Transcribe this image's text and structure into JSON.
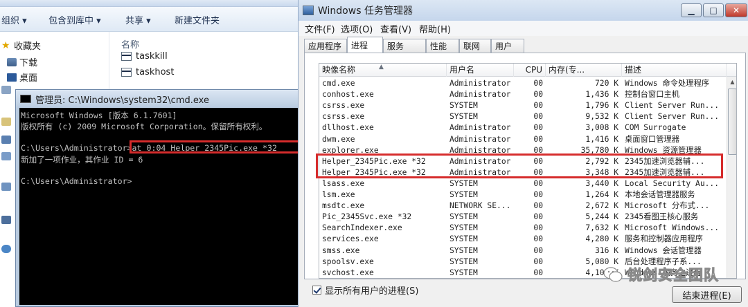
{
  "explorer": {
    "toolbar": {
      "organize": "组织 ▾",
      "include_in_library": "包含到库中 ▾",
      "share": "共享 ▾",
      "new_folder": "新建文件夹"
    },
    "nav": {
      "favorites": "收藏夹",
      "downloads": "下载",
      "desktop": "桌面"
    },
    "list": {
      "column_name": "名称",
      "files": [
        "taskkill",
        "taskhost"
      ]
    }
  },
  "cmd": {
    "title": "管理员: C:\\Windows\\system32\\cmd.exe",
    "lines": [
      "Microsoft Windows [版本 6.1.7601]",
      "版权所有 (c) 2009 Microsoft Corporation。保留所有权利。",
      "",
      "C:\\Users\\Administrator>at 0:04 Helper_2345Pic.exe *32",
      "新加了一项作业，其作业 ID = 6",
      "",
      "C:\\Users\\Administrator>"
    ]
  },
  "taskmgr": {
    "title": "Windows 任务管理器",
    "window_buttons": {
      "minimize": "▁",
      "maximize": "□",
      "close": "✕"
    },
    "menu": [
      "文件(F)",
      "选项(O)",
      "查看(V)",
      "帮助(H)"
    ],
    "tabs": [
      "应用程序",
      "进程",
      "服务",
      "性能",
      "联网",
      "用户"
    ],
    "active_tab": "进程",
    "columns": [
      "映像名称",
      "用户名",
      "CPU",
      "内存(专...",
      "描述"
    ],
    "processes": [
      {
        "name": "cmd.exe",
        "user": "Administrator",
        "cpu": "00",
        "mem": "720 K",
        "desc": "Windows 命令处理程序"
      },
      {
        "name": "conhost.exe",
        "user": "Administrator",
        "cpu": "00",
        "mem": "1,436 K",
        "desc": "控制台窗口主机"
      },
      {
        "name": "csrss.exe",
        "user": "SYSTEM",
        "cpu": "00",
        "mem": "1,796 K",
        "desc": "Client Server Run..."
      },
      {
        "name": "csrss.exe",
        "user": "SYSTEM",
        "cpu": "00",
        "mem": "9,532 K",
        "desc": "Client Server Run..."
      },
      {
        "name": "dllhost.exe",
        "user": "Administrator",
        "cpu": "00",
        "mem": "3,008 K",
        "desc": "COM Surrogate"
      },
      {
        "name": "dwm.exe",
        "user": "Administrator",
        "cpu": "00",
        "mem": "1,416 K",
        "desc": "桌面窗口管理器"
      },
      {
        "name": "explorer.exe",
        "user": "Administrator",
        "cpu": "00",
        "mem": "35,780 K",
        "desc": "Windows 资源管理器"
      },
      {
        "name": "Helper_2345Pic.exe *32",
        "user": "Administrator",
        "cpu": "00",
        "mem": "2,792 K",
        "desc": "2345加速浏览器辅..."
      },
      {
        "name": "Helper_2345Pic.exe *32",
        "user": "Administrator",
        "cpu": "00",
        "mem": "3,348 K",
        "desc": "2345加速浏览器辅..."
      },
      {
        "name": "lsass.exe",
        "user": "SYSTEM",
        "cpu": "00",
        "mem": "3,440 K",
        "desc": "Local Security Au..."
      },
      {
        "name": "lsm.exe",
        "user": "SYSTEM",
        "cpu": "00",
        "mem": "1,264 K",
        "desc": "本地会话管理器服务"
      },
      {
        "name": "msdtc.exe",
        "user": "NETWORK SE...",
        "cpu": "00",
        "mem": "2,672 K",
        "desc": "Microsoft 分布式..."
      },
      {
        "name": "Pic_2345Svc.exe *32",
        "user": "SYSTEM",
        "cpu": "00",
        "mem": "5,244 K",
        "desc": "2345看图王核心服务"
      },
      {
        "name": "SearchIndexer.exe",
        "user": "SYSTEM",
        "cpu": "00",
        "mem": "7,632 K",
        "desc": "Microsoft Windows..."
      },
      {
        "name": "services.exe",
        "user": "SYSTEM",
        "cpu": "00",
        "mem": "4,280 K",
        "desc": "服务和控制器应用程序"
      },
      {
        "name": "smss.exe",
        "user": "SYSTEM",
        "cpu": "00",
        "mem": "316 K",
        "desc": "Windows 会话管理器"
      },
      {
        "name": "spoolsv.exe",
        "user": "SYSTEM",
        "cpu": "00",
        "mem": "5,080 K",
        "desc": "后台处理程序子系..."
      },
      {
        "name": "svchost.exe",
        "user": "SYSTEM",
        "cpu": "00",
        "mem": "4,104 K",
        "desc": "Windows 服务主进程"
      }
    ],
    "show_all_users": "显示所有用户的进程(S)",
    "end_process": "结束进程(E)"
  },
  "watermark": "锐剑安全团队",
  "colors": {
    "highlight": "#d62c2c",
    "console_bg": "#000000",
    "console_fg": "#c0c0c0"
  }
}
